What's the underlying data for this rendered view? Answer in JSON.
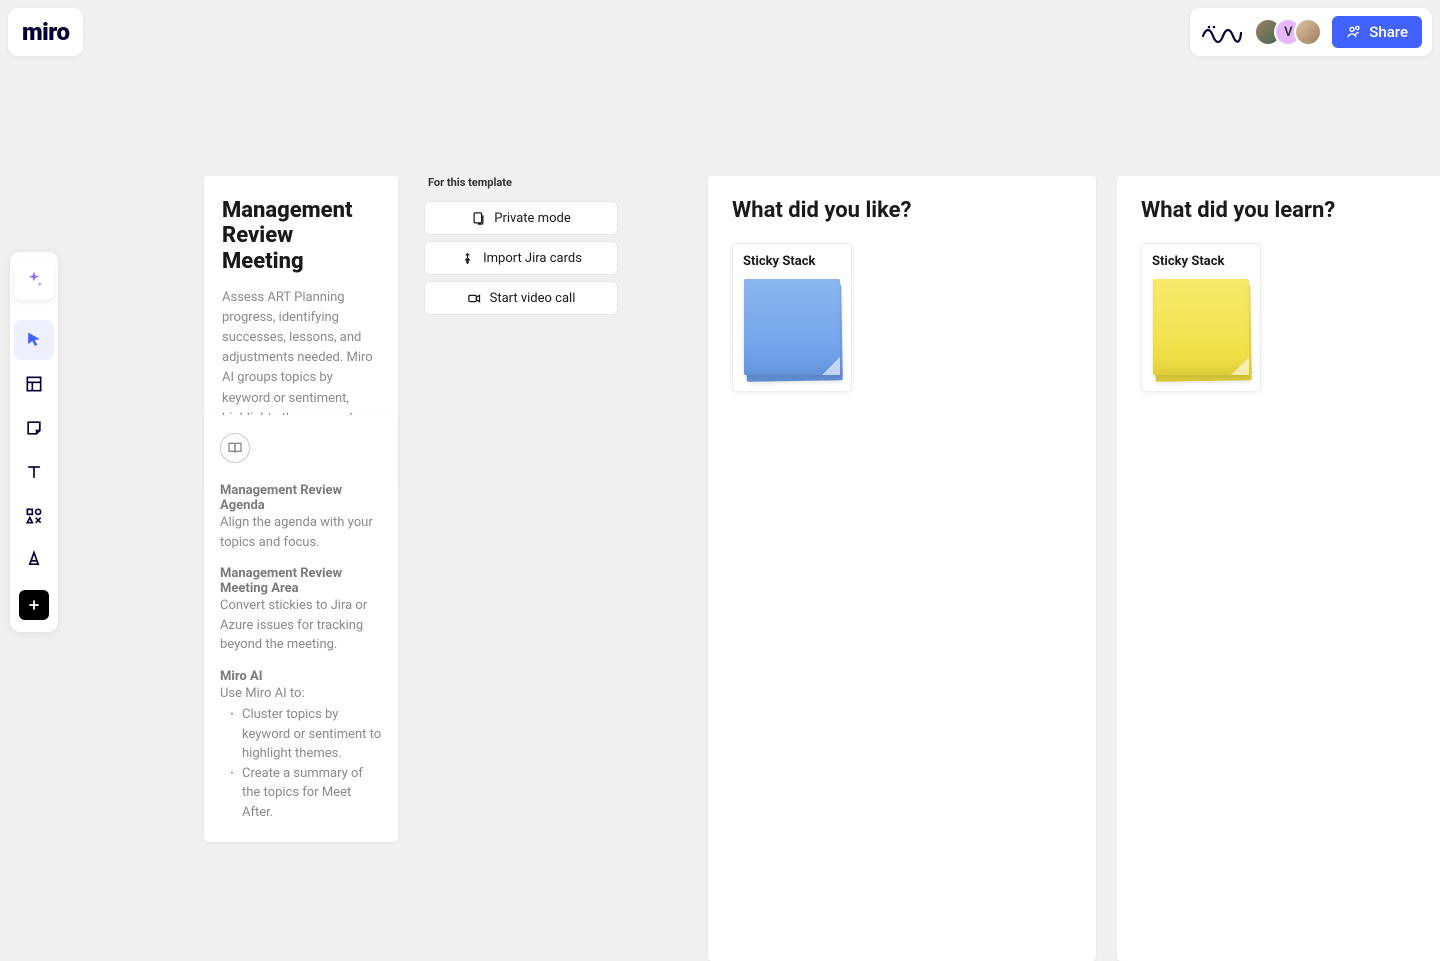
{
  "app": {
    "logo_text": "miro"
  },
  "header": {
    "share_label": "Share",
    "avatar_labels": [
      "",
      "V",
      ""
    ]
  },
  "toolbar": {
    "tools": [
      "ai",
      "select",
      "frame",
      "sticky",
      "text",
      "apps",
      "highlighter",
      "add"
    ]
  },
  "intro": {
    "title": "Management Review Meeting",
    "body": "Assess ART Planning progress, identifying successes, lessons, and adjustments needed. Miro AI groups topics by keyword or sentiment, highlights themes, and generates summaries for follow-up."
  },
  "agenda": {
    "sections": [
      {
        "title": "Management Review Agenda",
        "body": "Align the agenda with your topics and focus."
      },
      {
        "title": "Management Review Meeting Area",
        "body": "Convert stickies to Jira or Azure issues for tracking beyond the meeting."
      },
      {
        "title": "Miro AI",
        "body": "Use Miro AI to:"
      }
    ],
    "ai_bullets": [
      "Cluster topics by keyword or sentiment to highlight themes.",
      "Create a summary of the topics for Meet After."
    ]
  },
  "template_actions": {
    "header": "For this template",
    "buttons": [
      {
        "id": "private-mode",
        "label": "Private mode"
      },
      {
        "id": "import-jira",
        "label": "Import Jira cards"
      },
      {
        "id": "start-video",
        "label": "Start video call"
      }
    ]
  },
  "columns": [
    {
      "title": "What did you like?",
      "sticky_label": "Sticky Stack",
      "note_color": "blue"
    },
    {
      "title": "What did you learn?",
      "sticky_label": "Sticky Stack",
      "note_color": "yellow"
    }
  ]
}
